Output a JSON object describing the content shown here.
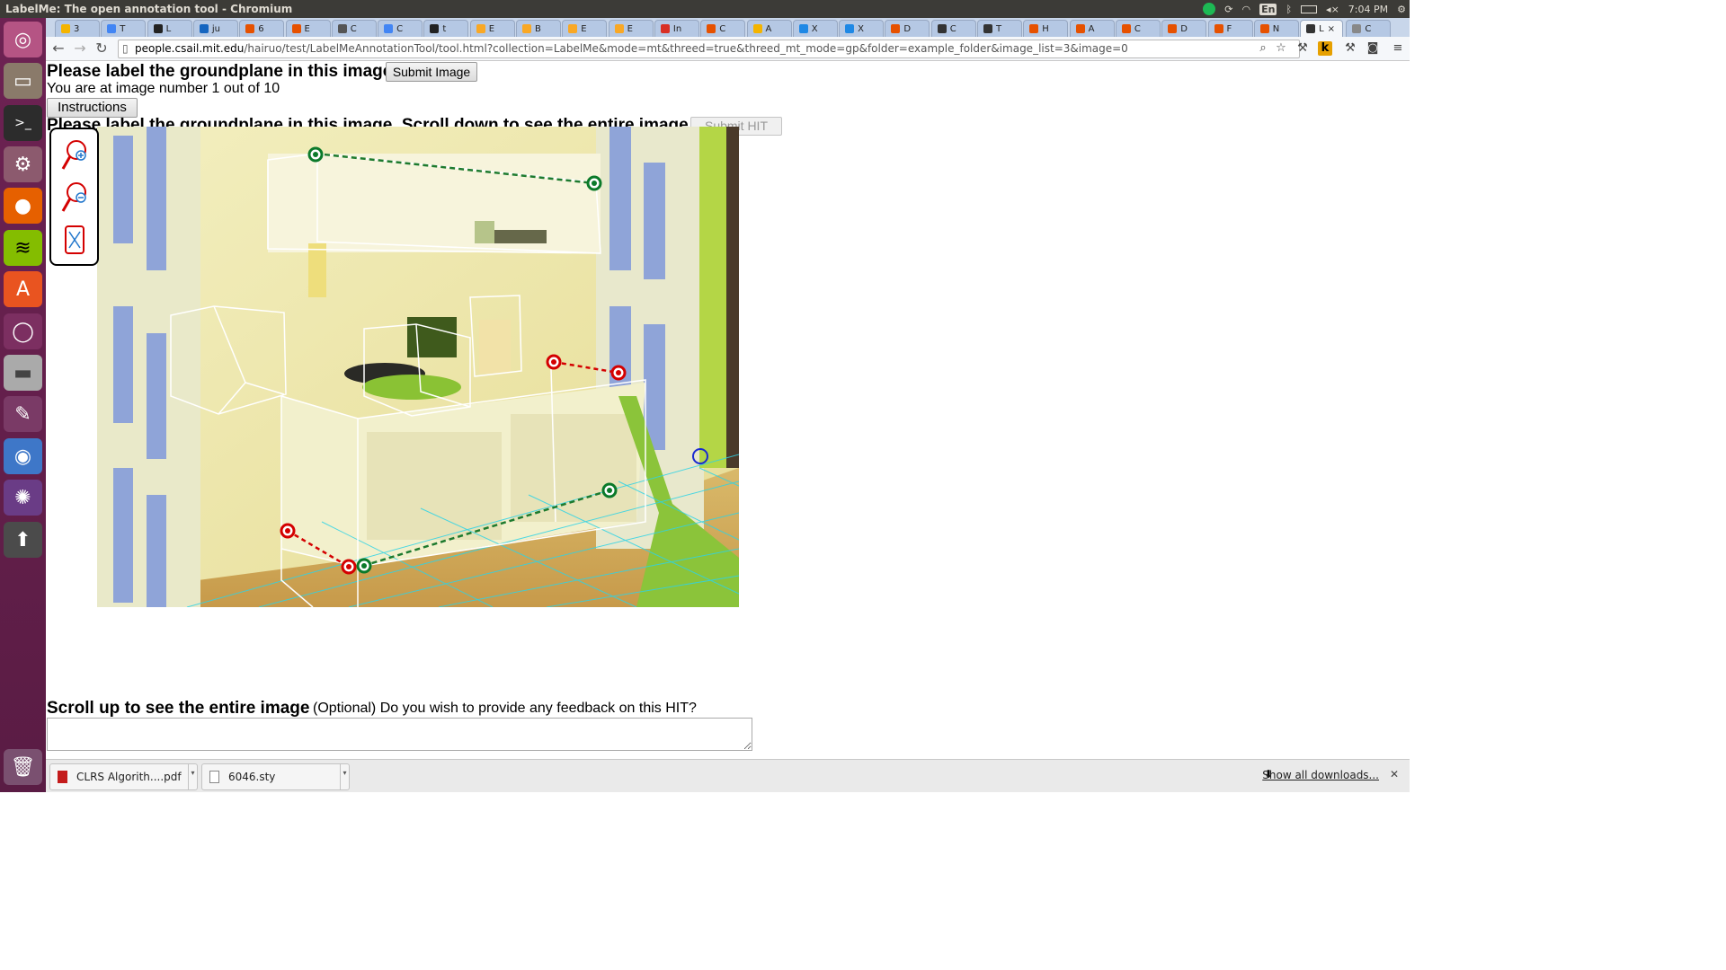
{
  "window": {
    "title": "LabelMe: The open annotation tool - Chromium"
  },
  "panel": {
    "keyboard_layout": "En",
    "clock": "7:04 PM"
  },
  "tabs": [
    {
      "label": "3",
      "color": "#f4b400"
    },
    {
      "label": "T",
      "color": "#4285f4"
    },
    {
      "label": "L",
      "color": "#222222"
    },
    {
      "label": "ju",
      "color": "#1565c0"
    },
    {
      "label": "6",
      "color": "#e65100"
    },
    {
      "label": "E",
      "color": "#e65100"
    },
    {
      "label": "C",
      "color": "#555555"
    },
    {
      "label": "C",
      "color": "#4285f4"
    },
    {
      "label": "t",
      "color": "#222222"
    },
    {
      "label": "E",
      "color": "#f9a825"
    },
    {
      "label": "B",
      "color": "#f9a825"
    },
    {
      "label": "E",
      "color": "#f9a825"
    },
    {
      "label": "E",
      "color": "#f9a825"
    },
    {
      "label": "In",
      "color": "#d93025"
    },
    {
      "label": "C",
      "color": "#e65100"
    },
    {
      "label": "A",
      "color": "#f4b400"
    },
    {
      "label": "X",
      "color": "#1e88e5"
    },
    {
      "label": "X",
      "color": "#1e88e5"
    },
    {
      "label": "D",
      "color": "#e65100"
    },
    {
      "label": "C",
      "color": "#333333"
    },
    {
      "label": "T",
      "color": "#333333"
    },
    {
      "label": "H",
      "color": "#e65100"
    },
    {
      "label": "A",
      "color": "#e65100"
    },
    {
      "label": "C",
      "color": "#e65100"
    },
    {
      "label": "D",
      "color": "#e65100"
    },
    {
      "label": "F",
      "color": "#e65100"
    },
    {
      "label": "N",
      "color": "#e65100"
    },
    {
      "label": "L",
      "color": "#333333",
      "active": true
    },
    {
      "label": "C",
      "color": "#888888"
    }
  ],
  "address": {
    "host": "people.csail.mit.edu",
    "path": "/hairuo/test/LabelMeAnnotationTool/tool.html?collection=LabelMe&mode=mt&threed=true&threed_mt_mode=gp&folder=example_folder&image_list=3&image=0"
  },
  "page": {
    "heading": "Please label the groundplane in this image.",
    "submit_image": "Submit Image",
    "progress_text": "You are at image number 1 out of 10",
    "instructions": "Instructions",
    "heading2": "Please label the groundplane in this image. Scroll down to see the entire image.",
    "submit_hit": "Submit HIT",
    "scroll_up": "Scroll up to see the entire image",
    "feedback_prompt": "(Optional) Do you wish to provide any feedback on this HIT?",
    "feedback_value": ""
  },
  "zoom_tools": {
    "zoom_in": "zoom-in-icon",
    "zoom_out": "zoom-out-icon",
    "fit": "fit-image-icon"
  },
  "downloads": {
    "items": [
      {
        "name": "CLRS Algorith....pdf"
      },
      {
        "name": "6046.sty"
      }
    ],
    "show_all": "Show all downloads..."
  }
}
